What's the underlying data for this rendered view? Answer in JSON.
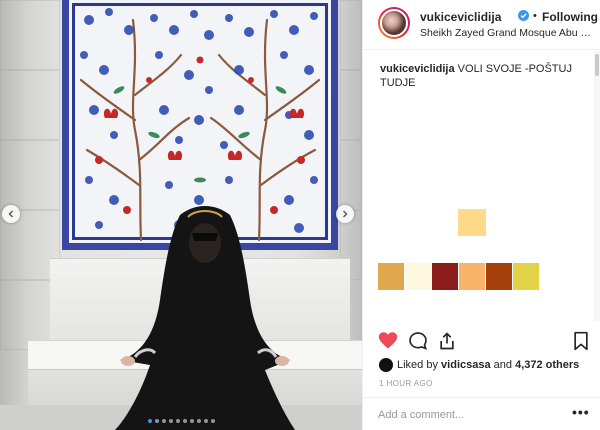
{
  "post": {
    "username": "vukiceviclidija",
    "bullet": "•",
    "follow_status": "Following",
    "location": "Sheikh Zayed Grand Mosque Abu Dhabi, U...",
    "caption_user": "vukiceviclidija",
    "caption_text": "VOLI SVOJE -POŠTUJ TUDJE",
    "liked_by_prefix": "Liked by",
    "liked_by_user": "vidicsasa",
    "liked_by_join": "and",
    "liked_by_count": "4,372 others",
    "timestamp": "1 HOUR AGO",
    "comment_placeholder": "Add a comment...",
    "more_label": "•••"
  },
  "carousel": {
    "total_dots": 10,
    "active_index": 0
  },
  "caption_swatches": {
    "single": "#ffd98a",
    "row": [
      "#e0a84e",
      "#fff8e1",
      "#8b1c1c",
      "#f8b26a",
      "#a6400b",
      "#e2d247"
    ]
  },
  "icons": {
    "verified": "verified-badge-icon",
    "like": "heart-icon",
    "comment": "comment-bubble-icon",
    "share": "share-icon",
    "save": "bookmark-icon",
    "prev": "chevron-left-icon",
    "next": "chevron-right-icon"
  },
  "colors": {
    "like": "#ed4956",
    "verified": "#3897f0",
    "text": "#262626",
    "muted": "#999999",
    "tile_blue": "#2c3a8e"
  }
}
